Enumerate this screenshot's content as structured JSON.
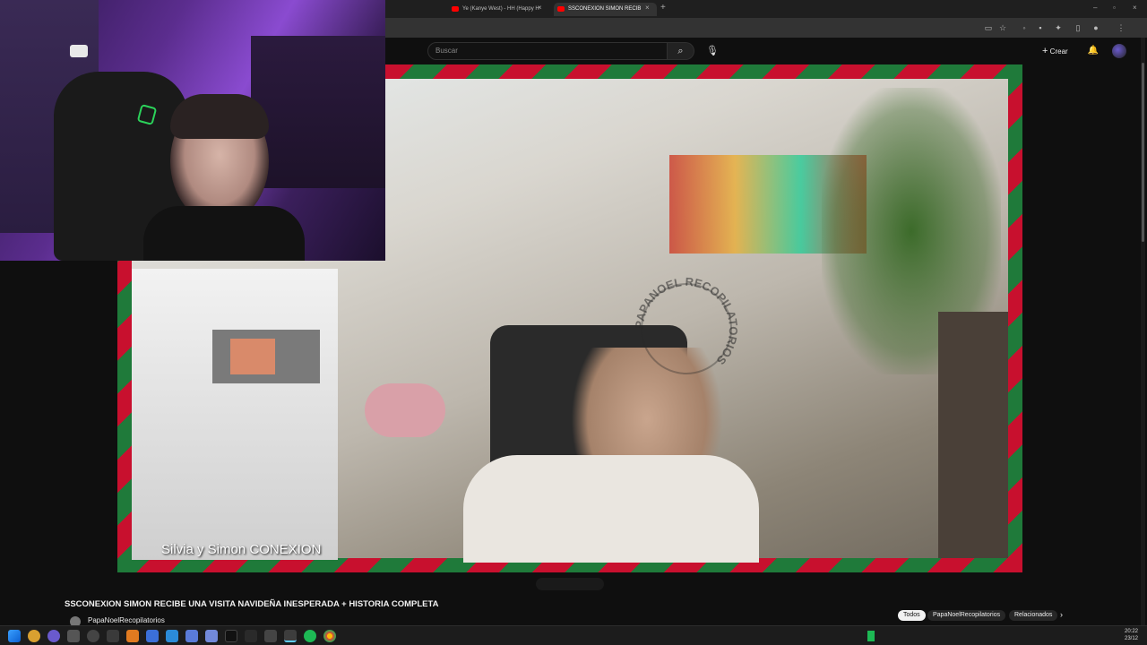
{
  "browser": {
    "tabs": [
      {
        "title": "Ye (Kanye West) - HH (Happy H",
        "active": false
      },
      {
        "title": "SSCONEXION SIMON RECIB",
        "active": true
      }
    ],
    "new_tab_icon": "plus-icon"
  },
  "youtube": {
    "search_placeholder": "Buscar",
    "create_label": "Crear"
  },
  "video": {
    "caption": "Silvia y Simon CONEXION",
    "watermark_text": "PAPANOEL RECOPILATORIOS",
    "frame_colors": {
      "red": "#c8102e",
      "green": "#1f7a3a"
    }
  },
  "below": {
    "title": "SSCONEXION SIMON RECIBE UNA VISITA NAVIDEÑA INESPERADA + HISTORIA COMPLETA",
    "channel": "PapaNoelRecopilatorios",
    "chips": [
      {
        "label": "Todos",
        "active": true
      },
      {
        "label": "PapaNoelRecopilatorios",
        "active": false
      },
      {
        "label": "Relacionados",
        "active": false
      }
    ]
  },
  "taskbar": {
    "time": "20:22",
    "date": "23/12"
  }
}
